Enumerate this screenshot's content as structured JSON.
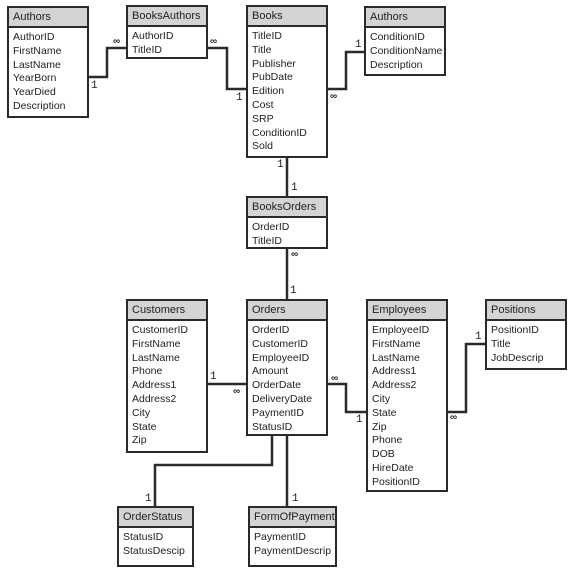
{
  "diagram": {
    "tables": {
      "authors": {
        "title": "Authors",
        "fields": [
          "AuthorID",
          "FirstName",
          "LastName",
          "YearBorn",
          "YearDied",
          "Description"
        ]
      },
      "books_authors": {
        "title": "BooksAuthors",
        "fields": [
          "AuthorID",
          "TitleID"
        ]
      },
      "books": {
        "title": "Books",
        "fields": [
          "TitleID",
          "Title",
          "Publisher",
          "PubDate",
          "Edition",
          "Cost",
          "SRP",
          "ConditionID",
          "Sold"
        ]
      },
      "conditions": {
        "title": "Authors",
        "fields": [
          "ConditionID",
          "ConditionName",
          "Description"
        ]
      },
      "books_orders": {
        "title": "BooksOrders",
        "fields": [
          "OrderID",
          "TitleID"
        ]
      },
      "customers": {
        "title": "Customers",
        "fields": [
          "CustomerID",
          "FirstName",
          "LastName",
          "Phone",
          "Address1",
          "Address2",
          "City",
          "State",
          "Zip"
        ]
      },
      "orders": {
        "title": "Orders",
        "fields": [
          "OrderID",
          "CustomerID",
          "EmployeeID",
          "Amount",
          "OrderDate",
          "DeliveryDate",
          "PaymentID",
          "StatusID"
        ]
      },
      "employees": {
        "title": "Employees",
        "fields": [
          "EmployeeID",
          "FirstName",
          "LastName",
          "Address1",
          "Address2",
          "City",
          "State",
          "Zip",
          "Phone",
          "DOB",
          "HireDate",
          "PositionID"
        ]
      },
      "positions": {
        "title": "Positions",
        "fields": [
          "PositionID",
          "Title",
          "JobDescrip"
        ]
      },
      "order_status": {
        "title": "OrderStatus",
        "fields": [
          "StatusID",
          "StatusDescip"
        ]
      },
      "form_of_payment": {
        "title": "FormOfPayment",
        "fields": [
          "PaymentID",
          "PaymentDescrip"
        ]
      }
    },
    "cardinality": {
      "one": "1",
      "many": "∞"
    },
    "relationships": [
      {
        "from": "Authors",
        "from_card": "1",
        "to": "BooksAuthors",
        "to_card": "∞"
      },
      {
        "from": "Books",
        "from_card": "1",
        "to": "BooksAuthors",
        "to_card": "∞"
      },
      {
        "from": "Authors (Conditions)",
        "from_card": "1",
        "to": "Books",
        "to_card": "∞"
      },
      {
        "from": "Books",
        "from_card": "1",
        "to": "BooksOrders",
        "to_card": "1"
      },
      {
        "from": "Orders",
        "from_card": "1",
        "to": "BooksOrders",
        "to_card": "∞"
      },
      {
        "from": "Customers",
        "from_card": "1",
        "to": "Orders",
        "to_card": "∞"
      },
      {
        "from": "Employees",
        "from_card": "1",
        "to": "Orders",
        "to_card": "∞"
      },
      {
        "from": "Positions",
        "from_card": "1",
        "to": "Employees",
        "to_card": "∞"
      },
      {
        "from": "OrderStatus",
        "from_card": "1",
        "to": "Orders",
        "to_card": ""
      },
      {
        "from": "FormOfPayment",
        "from_card": "1",
        "to": "Orders",
        "to_card": ""
      }
    ]
  }
}
